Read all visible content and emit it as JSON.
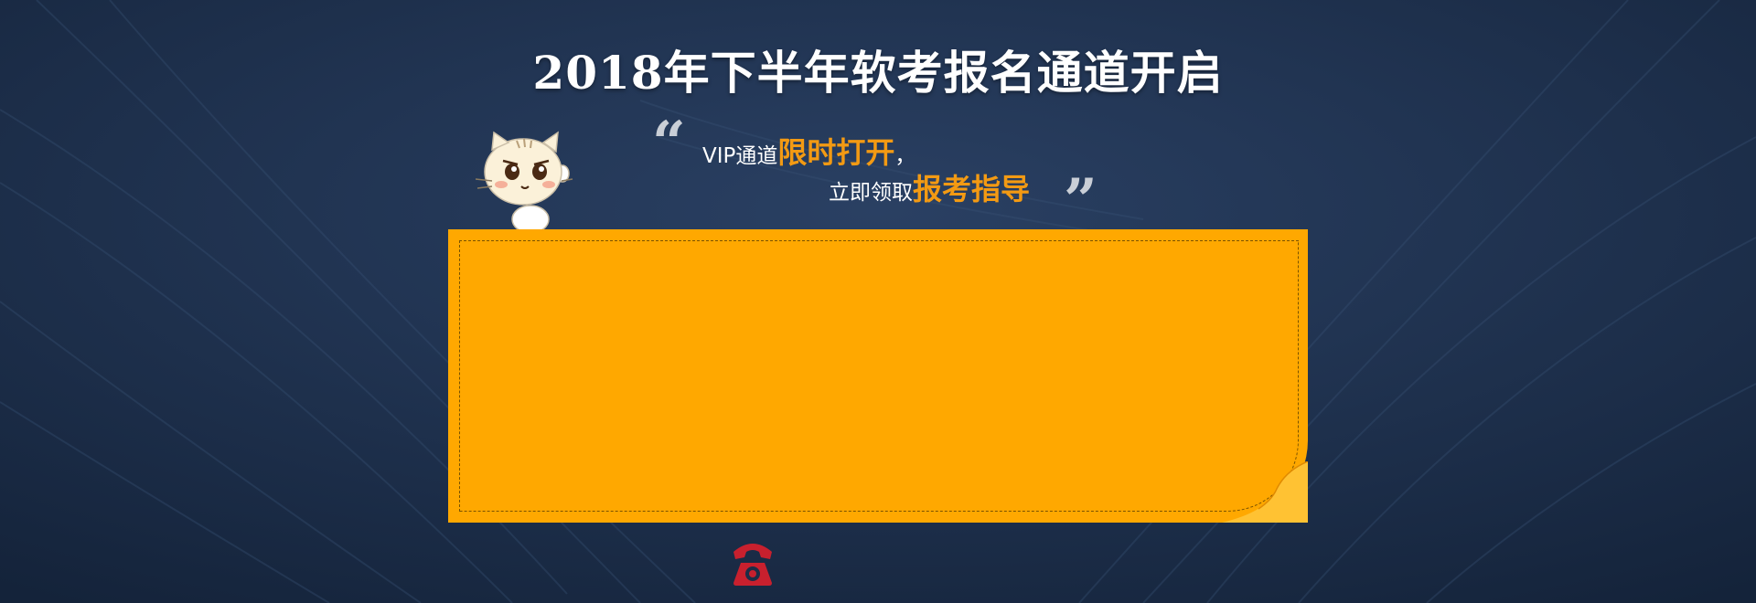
{
  "banner": {
    "title": "2018年下半年软考报名通道开启",
    "line1_prefix": "VIP通道",
    "line1_highlight": "限时打开",
    "line1_suffix": "，",
    "line2_prefix": "立即领取",
    "line2_highlight": "报考指导",
    "open_quote": "“",
    "close_quote": "”"
  },
  "colors": {
    "background": "#1c2d47",
    "accent_orange": "#f39a13",
    "card": "#ffa800",
    "phone": "#c8202e"
  },
  "icons": [
    "cat-mascot-icon",
    "telephone-icon"
  ]
}
